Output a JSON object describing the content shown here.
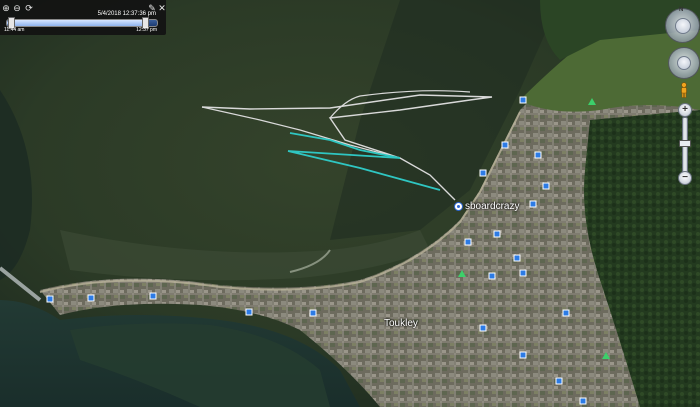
{
  "time_slider": {
    "date_time": "5/4/2018 12:37:36 pm",
    "start_label": "11:44 am",
    "end_label": "12:37 pm",
    "progress": 0.93,
    "icons": [
      "zoom-in-icon",
      "zoom-out-icon",
      "loop-icon",
      "wrench-icon",
      "close-icon"
    ]
  },
  "map": {
    "placemark_label": "sboardcrazy",
    "town_label": "Toukley",
    "track_colors": {
      "path": "#d9d9d9",
      "highlight": "#2fc6c2"
    },
    "navigation_controls": [
      "look-control",
      "move-control",
      "pegman-icon",
      "zoom-slider"
    ]
  }
}
